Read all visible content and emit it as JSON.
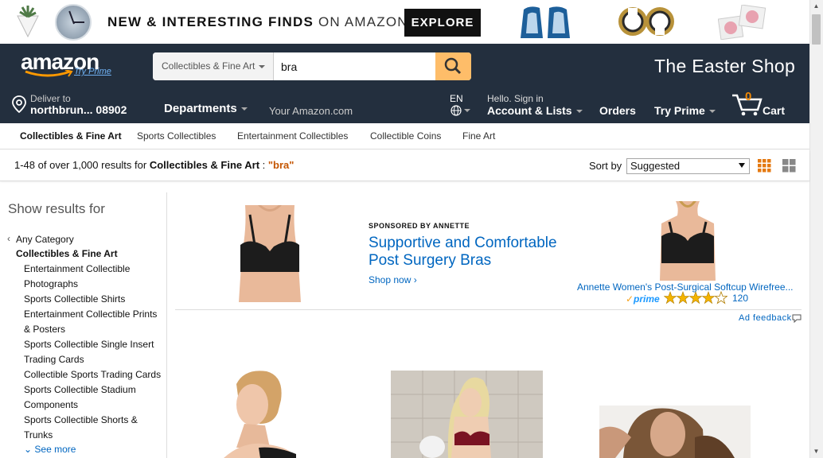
{
  "promo": {
    "headline_bold": "NEW & INTERESTING FINDS",
    "headline_light": "ON AMAZON",
    "explore_label": "EXPLORE"
  },
  "header": {
    "logo_text": "amazon",
    "try_prime_link": "Try Prime",
    "search": {
      "department": "Collectibles & Fine Art",
      "query": "bra"
    },
    "shop_banner": "The Easter Shop",
    "deliver_to_label": "Deliver to",
    "deliver_to_location": "northbrun... 08902",
    "departments_label": "Departments",
    "your_amazon": "Your Amazon.com",
    "language": "EN",
    "hello_sign_in": "Hello. Sign in",
    "account_lists": "Account & Lists",
    "orders": "Orders",
    "try_prime": "Try Prime",
    "cart_count": "0",
    "cart_label": "Cart"
  },
  "subnav": {
    "items": [
      {
        "label": "Collectibles & Fine Art",
        "active": true
      },
      {
        "label": "Sports Collectibles"
      },
      {
        "label": "Entertainment Collectibles"
      },
      {
        "label": "Collectible Coins"
      },
      {
        "label": "Fine Art"
      }
    ]
  },
  "results": {
    "count_text": "1-48 of over 1,000 results for",
    "category": "Collectibles & Fine Art",
    "separator": " : ",
    "query_quoted": "\"bra\"",
    "sort_label": "Sort by",
    "sort_value": "Suggested"
  },
  "sidebar": {
    "title": "Show results for",
    "any_category": "Any Category",
    "current": "Collectibles & Fine Art",
    "items": [
      "Entertainment Collectible",
      "Photographs",
      "Sports Collectible Shirts",
      "Entertainment Collectible Prints",
      "& Posters",
      "Sports Collectible Single Insert",
      "Trading Cards",
      "Collectible Sports Trading Cards",
      "Sports Collectible Stadium",
      "Components",
      "Sports Collectible Shorts &",
      "Trunks"
    ],
    "see_more": "See more"
  },
  "ad": {
    "sponsored_by": "SPONSORED BY ANNETTE",
    "headline": "Supportive and Comfortable Post Surgery Bras",
    "shop_now": "Shop now",
    "product_title": "Annette Women's Post-Surgical Softcup Wirefree...",
    "prime_label": "prime",
    "rating": 4,
    "review_count": "120",
    "ad_feedback": "Ad feedback"
  },
  "colors": {
    "nav_bg": "#232f3e",
    "search_button": "#febd69",
    "link": "#0066c0",
    "query_highlight": "#c45500",
    "cart_count": "#f08804"
  }
}
